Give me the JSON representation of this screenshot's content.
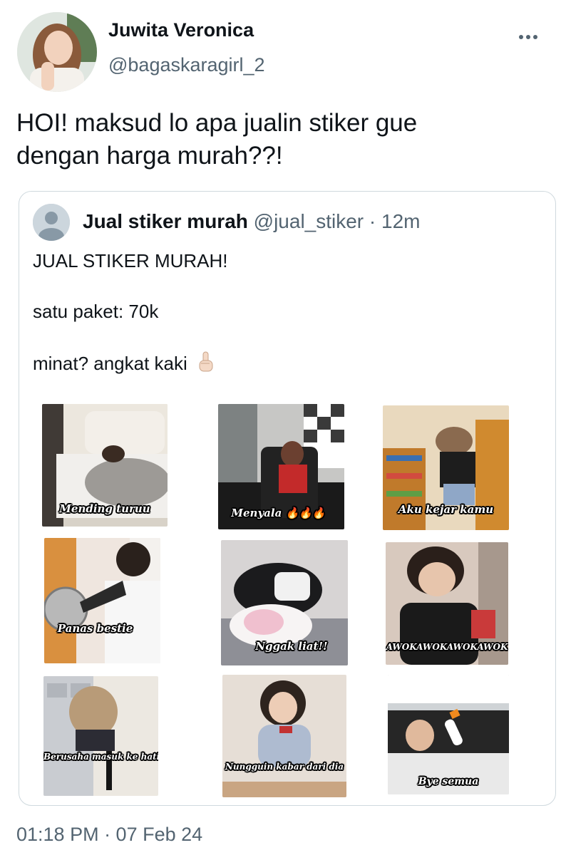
{
  "author": {
    "display_name": "Juwita Veronica",
    "handle": "@bagaskaragirl_2",
    "avatar_icon": "profile-photo"
  },
  "tweet": {
    "line1": "HOI! maksud lo apa jualin stiker gue",
    "line2": "dengan harga murah??!",
    "timestamp": "01:18 PM · 07 Feb 24"
  },
  "more_icon": "more-horizontal-icon",
  "quoted": {
    "display_name": "Jual stiker murah",
    "handle": "@jual_stiker",
    "separator": "·",
    "time": "12m",
    "avatar_icon": "default-avatar-icon",
    "line1": "JUAL STIKER MURAH!",
    "line2": "satu paket: 70k",
    "line3": "minat? angkat kaki",
    "emoji_icon": "raised-index-finger-emoji"
  },
  "stickers": [
    {
      "caption": "Mending turuu"
    },
    {
      "caption": "Menyala 🔥🔥🔥"
    },
    {
      "caption": "Aku kejar kamu"
    },
    {
      "caption": "Panas bestie"
    },
    {
      "caption": "Nggak liat!!"
    },
    {
      "caption": "AWOKAWOKAWOKAWOK"
    },
    {
      "caption": "Berusaha masuk ke hatimu"
    },
    {
      "caption": "Nungguin kabar dari dia"
    },
    {
      "caption": "Bye semua"
    }
  ],
  "colors": {
    "text": "#0f1419",
    "secondary": "#536471",
    "border": "#cfd9de",
    "caption_text": "#ffffff",
    "caption_outline": "#000000"
  }
}
